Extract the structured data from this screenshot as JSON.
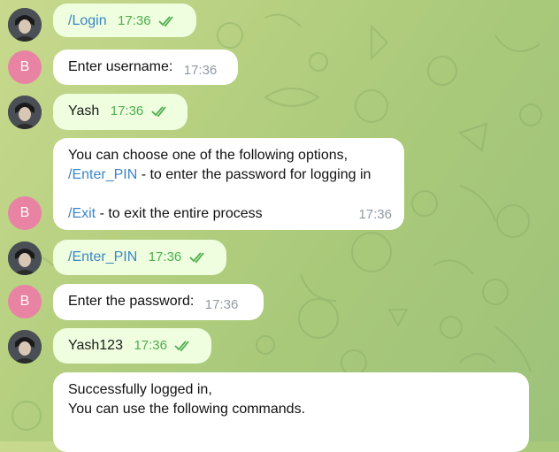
{
  "chat": {
    "messages": [
      {
        "sender": "user",
        "text": "/Login",
        "time": "17:36",
        "is_command": true
      },
      {
        "sender": "bot",
        "avatar_letter": "B",
        "text": "Enter username:",
        "time": "17:36"
      },
      {
        "sender": "user",
        "text": "Yash",
        "time": "17:36"
      },
      {
        "sender": "bot",
        "avatar_letter": "B",
        "line1": "You can choose one of the following options,",
        "cmd1": "/Enter_PIN",
        "cmd1_desc": " - to enter the password for logging in",
        "cmd2": "/Exit",
        "cmd2_desc": " - to exit the entire process",
        "time": "17:36"
      },
      {
        "sender": "user",
        "text": "/Enter_PIN",
        "time": "17:36",
        "is_command": true
      },
      {
        "sender": "bot",
        "avatar_letter": "B",
        "text": "Enter the password:",
        "time": "17:36"
      },
      {
        "sender": "user",
        "text": "Yash123",
        "time": "17:36"
      },
      {
        "sender": "bot",
        "line1": "Successfully logged in,",
        "line2": "You can use the following commands."
      }
    ]
  },
  "colors": {
    "outgoing_bubble": "#eefedf",
    "incoming_bubble": "#ffffff",
    "link": "#3b86c6",
    "read_ticks": "#4fae4e",
    "bot_avatar": "#e883a4"
  },
  "icons": {
    "read_status": "double-check-icon",
    "user_avatar": "user-avatar-icon"
  }
}
